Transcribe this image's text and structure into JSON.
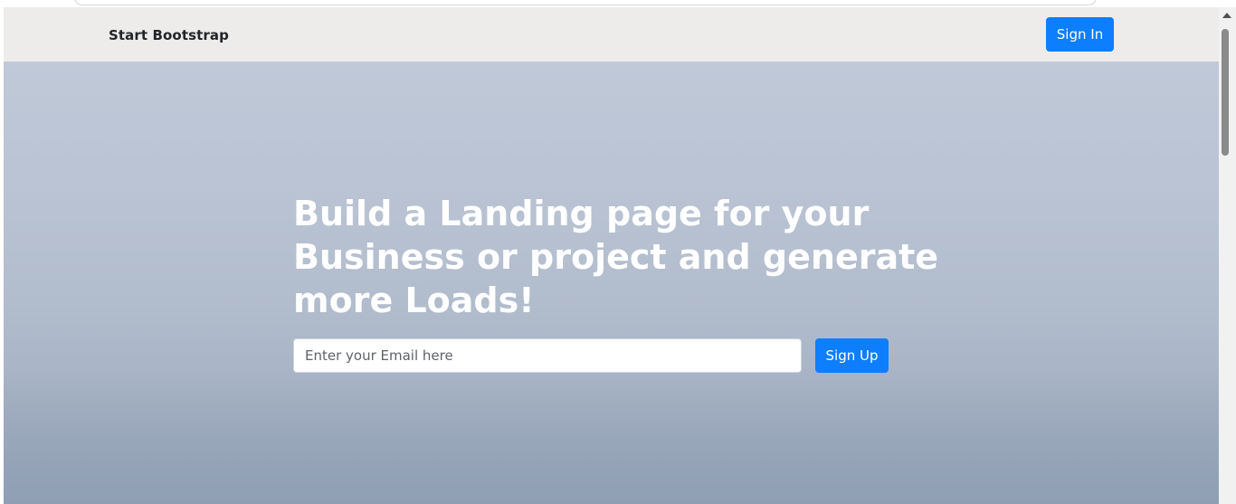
{
  "navbar": {
    "brand": "Start Bootstrap",
    "signin_label": "Sign In"
  },
  "hero": {
    "headline": "Build a Landing page for your Business or project and generate more Loads!",
    "email_placeholder": "Enter your Email here",
    "signup_label": "Sign Up"
  },
  "colors": {
    "accent": "#0d7efd",
    "navbar_bg": "#edeceb"
  },
  "icons": [
    "scroll-up-arrow-icon"
  ]
}
